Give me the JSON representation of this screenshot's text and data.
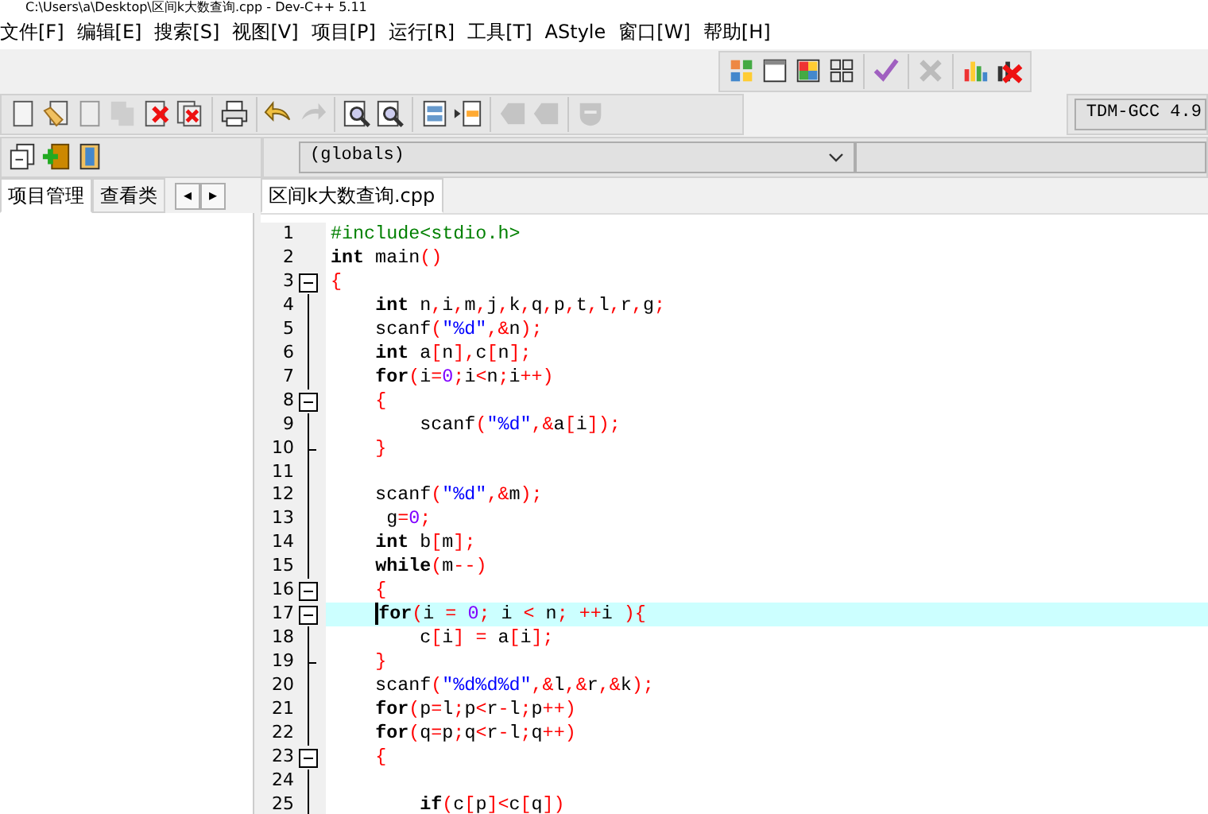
{
  "window": {
    "title": "C:\\Users\\a\\Desktop\\区间k大数查询.cpp - Dev-C++ 5.11"
  },
  "menu": [
    "文件[F]",
    "编辑[E]",
    "搜索[S]",
    "视图[V]",
    "项目[P]",
    "运行[R]",
    "工具[T]",
    "AStyle",
    "窗口[W]",
    "帮助[H]"
  ],
  "toolbar_top": [
    [
      {
        "kind": "tiles",
        "disabled": false
      },
      {
        "kind": "window",
        "disabled": false
      },
      {
        "kind": "quad",
        "disabled": false
      },
      {
        "kind": "grid",
        "disabled": false
      }
    ],
    [
      {
        "kind": "check",
        "disabled": false
      }
    ],
    [
      {
        "kind": "cross",
        "disabled": true
      }
    ],
    [
      {
        "kind": "chart",
        "disabled": false
      },
      {
        "kind": "chart-cross",
        "disabled": false
      }
    ]
  ],
  "toolbar_main": [
    [
      {
        "kind": "page",
        "disabled": false
      },
      {
        "kind": "open",
        "disabled": false
      },
      {
        "kind": "page",
        "disabled": true
      },
      {
        "kind": "pages",
        "disabled": true
      },
      {
        "kind": "close",
        "disabled": false
      },
      {
        "kind": "close-all",
        "disabled": false
      }
    ],
    [
      {
        "kind": "print",
        "disabled": false
      }
    ],
    [
      {
        "kind": "undo",
        "disabled": false
      },
      {
        "kind": "redo",
        "disabled": true
      }
    ],
    [
      {
        "kind": "find",
        "disabled": false
      },
      {
        "kind": "find",
        "disabled": false
      }
    ],
    [
      {
        "kind": "rows",
        "disabled": false
      },
      {
        "kind": "indent",
        "disabled": false
      }
    ],
    [
      {
        "kind": "back",
        "disabled": true
      },
      {
        "kind": "back",
        "disabled": true
      }
    ],
    [
      {
        "kind": "shield",
        "disabled": true
      }
    ]
  ],
  "compiler": {
    "value": "TDM-GCC 4.9"
  },
  "toolbar_project": [
    {
      "kind": "project",
      "disabled": false
    },
    {
      "kind": "add",
      "disabled": false
    },
    {
      "kind": "panel",
      "disabled": false
    }
  ],
  "scope": {
    "value": "(globals)"
  },
  "side_tabs": [
    {
      "label": "项目管理",
      "selected": true
    },
    {
      "label": "查看类",
      "selected": false
    }
  ],
  "side_arrows": [
    "◂",
    "▸"
  ],
  "editor_tabs": [
    {
      "label": "区间k大数查询.cpp",
      "selected": true
    }
  ],
  "lines": [
    {
      "number": "1",
      "fold_start": false,
      "fold_end": false,
      "current": false,
      "segments": [
        {
          "kind": "pre",
          "text": "#include<stdio.h>"
        }
      ]
    },
    {
      "number": "2",
      "fold_start": false,
      "fold_end": false,
      "current": false,
      "segments": [
        {
          "kind": "kw",
          "text": "int"
        },
        {
          "kind": "code",
          "text": " main()"
        }
      ]
    },
    {
      "number": "3",
      "fold_start": true,
      "fold_end": false,
      "current": false,
      "segments": [
        {
          "kind": "code",
          "text": "{"
        }
      ]
    },
    {
      "number": "4",
      "fold_start": false,
      "fold_end": false,
      "current": false,
      "segments": [
        {
          "kind": "kw",
          "text": "    int"
        },
        {
          "kind": "code",
          "text": " n,i,m,j,k,q,p,t,l,r,g;"
        }
      ]
    },
    {
      "number": "5",
      "fold_start": false,
      "fold_end": false,
      "current": false,
      "segments": [
        {
          "kind": "code",
          "text": "    scanf(\"%d\",&n);"
        }
      ]
    },
    {
      "number": "6",
      "fold_start": false,
      "fold_end": false,
      "current": false,
      "segments": [
        {
          "kind": "kw",
          "text": "    int"
        },
        {
          "kind": "code",
          "text": " a[n],c[n];"
        }
      ]
    },
    {
      "number": "7",
      "fold_start": false,
      "fold_end": false,
      "current": false,
      "segments": [
        {
          "kind": "kw",
          "text": "    for"
        },
        {
          "kind": "code",
          "text": "(i=0;i<n;i++)"
        }
      ]
    },
    {
      "number": "8",
      "fold_start": true,
      "fold_end": false,
      "current": false,
      "segments": [
        {
          "kind": "code",
          "text": "    {"
        }
      ]
    },
    {
      "number": "9",
      "fold_start": false,
      "fold_end": false,
      "current": false,
      "segments": [
        {
          "kind": "code",
          "text": "        scanf(\"%d\",&a[i]);"
        }
      ]
    },
    {
      "number": "10",
      "fold_start": false,
      "fold_end": true,
      "current": false,
      "segments": [
        {
          "kind": "code",
          "text": "    }"
        }
      ]
    },
    {
      "number": "11",
      "fold_start": false,
      "fold_end": false,
      "current": false
    },
    {
      "number": "12",
      "fold_start": false,
      "fold_end": false,
      "current": false,
      "segments": [
        {
          "kind": "code",
          "text": "    scanf(\"%d\",&m);"
        }
      ]
    },
    {
      "number": "13",
      "fold_start": false,
      "fold_end": false,
      "current": false,
      "segments": [
        {
          "kind": "code",
          "text": "     g=0;"
        }
      ]
    },
    {
      "number": "14",
      "fold_start": false,
      "fold_end": false,
      "current": false,
      "segments": [
        {
          "kind": "kw",
          "text": "    int"
        },
        {
          "kind": "code",
          "text": " b[m];"
        }
      ]
    },
    {
      "number": "15",
      "fold_start": false,
      "fold_end": false,
      "current": false,
      "segments": [
        {
          "kind": "kw",
          "text": "    while"
        },
        {
          "kind": "code",
          "text": "(m--)"
        }
      ]
    },
    {
      "number": "16",
      "fold_start": true,
      "fold_end": false,
      "current": false,
      "segments": [
        {
          "kind": "code",
          "text": "    {"
        }
      ]
    },
    {
      "number": "17",
      "fold_start": true,
      "fold_end": false,
      "current": true,
      "segments": [
        {
          "kind": "kw",
          "text": "    for"
        },
        {
          "kind": "code",
          "text": "(i = 0; i < n; ++i ){"
        }
      ]
    },
    {
      "number": "18",
      "fold_start": false,
      "fold_end": false,
      "current": false,
      "segments": [
        {
          "kind": "code",
          "text": "        c[i] = a[i];"
        }
      ]
    },
    {
      "number": "19",
      "fold_start": false,
      "fold_end": true,
      "current": false,
      "segments": [
        {
          "kind": "code",
          "text": "    }"
        }
      ]
    },
    {
      "number": "20",
      "fold_start": false,
      "fold_end": false,
      "current": false,
      "segments": [
        {
          "kind": "code",
          "text": "    scanf(\"%d%d%d\",&l,&r,&k);"
        }
      ]
    },
    {
      "number": "21",
      "fold_start": false,
      "fold_end": false,
      "current": false,
      "segments": [
        {
          "kind": "kw",
          "text": "    for"
        },
        {
          "kind": "code",
          "text": "(p=l;p<r-l;p++)"
        }
      ]
    },
    {
      "number": "22",
      "fold_start": false,
      "fold_end": false,
      "current": false,
      "segments": [
        {
          "kind": "kw",
          "text": "    for"
        },
        {
          "kind": "code",
          "text": "(q=p;q<r-l;q++)"
        }
      ]
    },
    {
      "number": "23",
      "fold_start": true,
      "fold_end": false,
      "current": false,
      "segments": [
        {
          "kind": "code",
          "text": "    {"
        }
      ]
    },
    {
      "number": "24",
      "fold_start": false,
      "fold_end": false,
      "current": false
    },
    {
      "number": "25",
      "fold_start": false,
      "fold_end": false,
      "current": false,
      "segments": [
        {
          "kind": "kw",
          "text": "        if"
        },
        {
          "kind": "code",
          "text": "(c[p]<c[q])"
        }
      ]
    }
  ]
}
